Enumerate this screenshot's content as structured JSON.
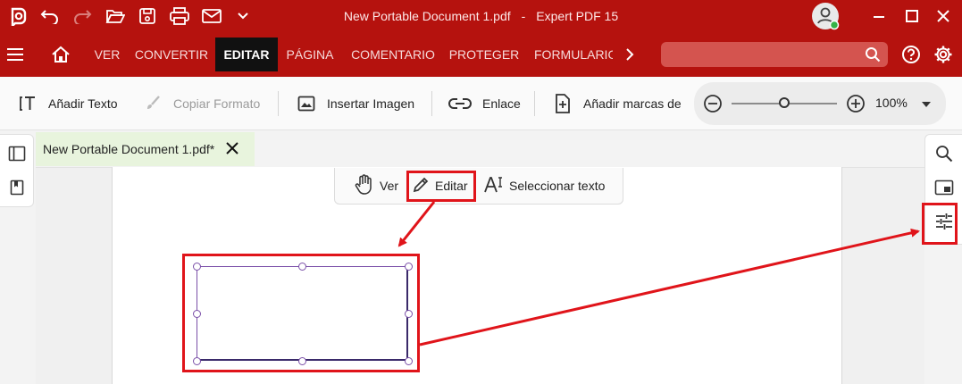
{
  "titlebar": {
    "document_name": "New Portable Document 1.pdf",
    "separator": "-",
    "app_name": "Expert PDF 15"
  },
  "ribbon": {
    "tabs": [
      {
        "label": "VER",
        "active": false
      },
      {
        "label": "CONVERTIR",
        "active": false
      },
      {
        "label": "EDITAR",
        "active": true
      },
      {
        "label": "PÁGINA",
        "active": false
      },
      {
        "label": "COMENTARIO",
        "active": false
      },
      {
        "label": "PROTEGER",
        "active": false
      },
      {
        "label": "FORMULARIOS",
        "active": false
      }
    ],
    "search": {
      "value": "",
      "placeholder": ""
    }
  },
  "toolbar": {
    "add_text": "Añadir Texto",
    "copy_format": "Copiar Formato",
    "insert_image": "Insertar Imagen",
    "link": "Enlace",
    "add_marks": "Añadir marcas de",
    "zoom_level": "100%",
    "zoom_slider_fraction": 0.5
  },
  "document_tab": {
    "label": "New Portable Document 1.pdf*"
  },
  "mode_bar": {
    "view": "Ver",
    "edit": "Editar",
    "select_text": "Seleccionar texto"
  },
  "colors": {
    "brand": "#b5120e",
    "active_tab": "#111111",
    "highlight": "#e0141a",
    "selection": "#7a4fa8"
  },
  "icons": {
    "app": "app-logo-icon",
    "undo": "undo-icon",
    "redo": "redo-icon",
    "open": "folder-open-icon",
    "save": "save-icon",
    "print": "printer-icon",
    "mail": "mail-icon",
    "menu": "hamburger-menu-icon",
    "home": "home-icon",
    "help": "help-icon",
    "settings": "gear-icon",
    "right_search": "search-icon",
    "right_panel": "window-icon",
    "right_properties": "sliders-icon"
  }
}
